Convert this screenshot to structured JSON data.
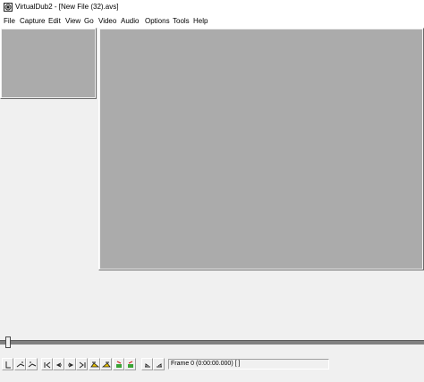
{
  "window": {
    "title": "VirtualDub2  - [New File (32).avs]",
    "icon": "virtualdub-app-icon"
  },
  "menu": {
    "items": [
      {
        "label": "File"
      },
      {
        "label": "Capture"
      },
      {
        "label": "Edit"
      },
      {
        "label": "View"
      },
      {
        "label": "Go"
      },
      {
        "label": "Video"
      },
      {
        "label": "Audio"
      },
      {
        "label": "Options"
      },
      {
        "label": "Tools"
      },
      {
        "label": "Help"
      }
    ]
  },
  "panes": {
    "input_color": "#ababab",
    "output_color": "#ababab"
  },
  "timeline": {
    "position_fraction": 0.0
  },
  "toolbar": {
    "buttons": [
      {
        "icon": "stop-icon"
      },
      {
        "icon": "play-input-icon"
      },
      {
        "icon": "play-output-icon"
      },
      {
        "icon": "go-start-icon"
      },
      {
        "icon": "step-back-icon"
      },
      {
        "icon": "step-forward-icon"
      },
      {
        "icon": "go-end-icon"
      },
      {
        "icon": "prev-keyframe-icon"
      },
      {
        "icon": "next-keyframe-icon"
      },
      {
        "icon": "scene-back-icon"
      },
      {
        "icon": "scene-forward-icon"
      },
      {
        "icon": "mark-in-icon"
      },
      {
        "icon": "mark-out-icon"
      }
    ],
    "frame_status": "Frame 0 (0:00:00.000) [ ]"
  }
}
